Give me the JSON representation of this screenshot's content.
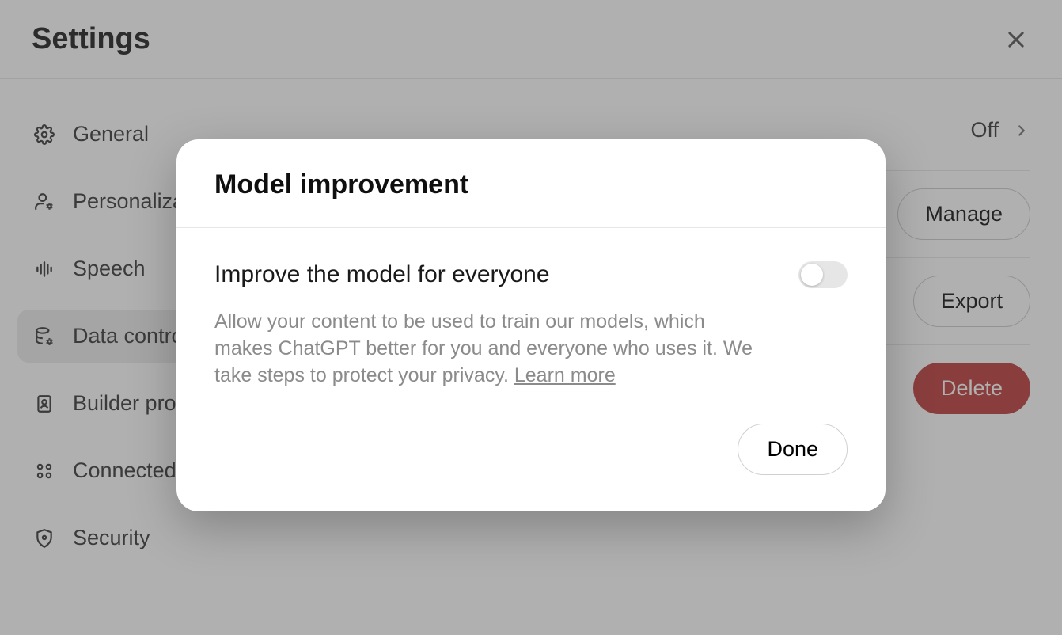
{
  "header": {
    "title": "Settings"
  },
  "sidebar": {
    "items": [
      {
        "label": "General"
      },
      {
        "label": "Personalization"
      },
      {
        "label": "Speech"
      },
      {
        "label": "Data controls"
      },
      {
        "label": "Builder profile"
      },
      {
        "label": "Connected apps"
      },
      {
        "label": "Security"
      }
    ]
  },
  "content": {
    "rows": [
      {
        "value": "Off"
      },
      {
        "button": "Manage"
      },
      {
        "button": "Export"
      },
      {
        "button": "Delete"
      }
    ]
  },
  "modal": {
    "title": "Model improvement",
    "setting_title": "Improve the model for everyone",
    "description_prefix": "Allow your content to be used to train our models, which makes ChatGPT better for you and everyone who uses it. We take steps to protect your privacy. ",
    "learn_more": "Learn more",
    "toggle_on": false,
    "done_label": "Done"
  }
}
